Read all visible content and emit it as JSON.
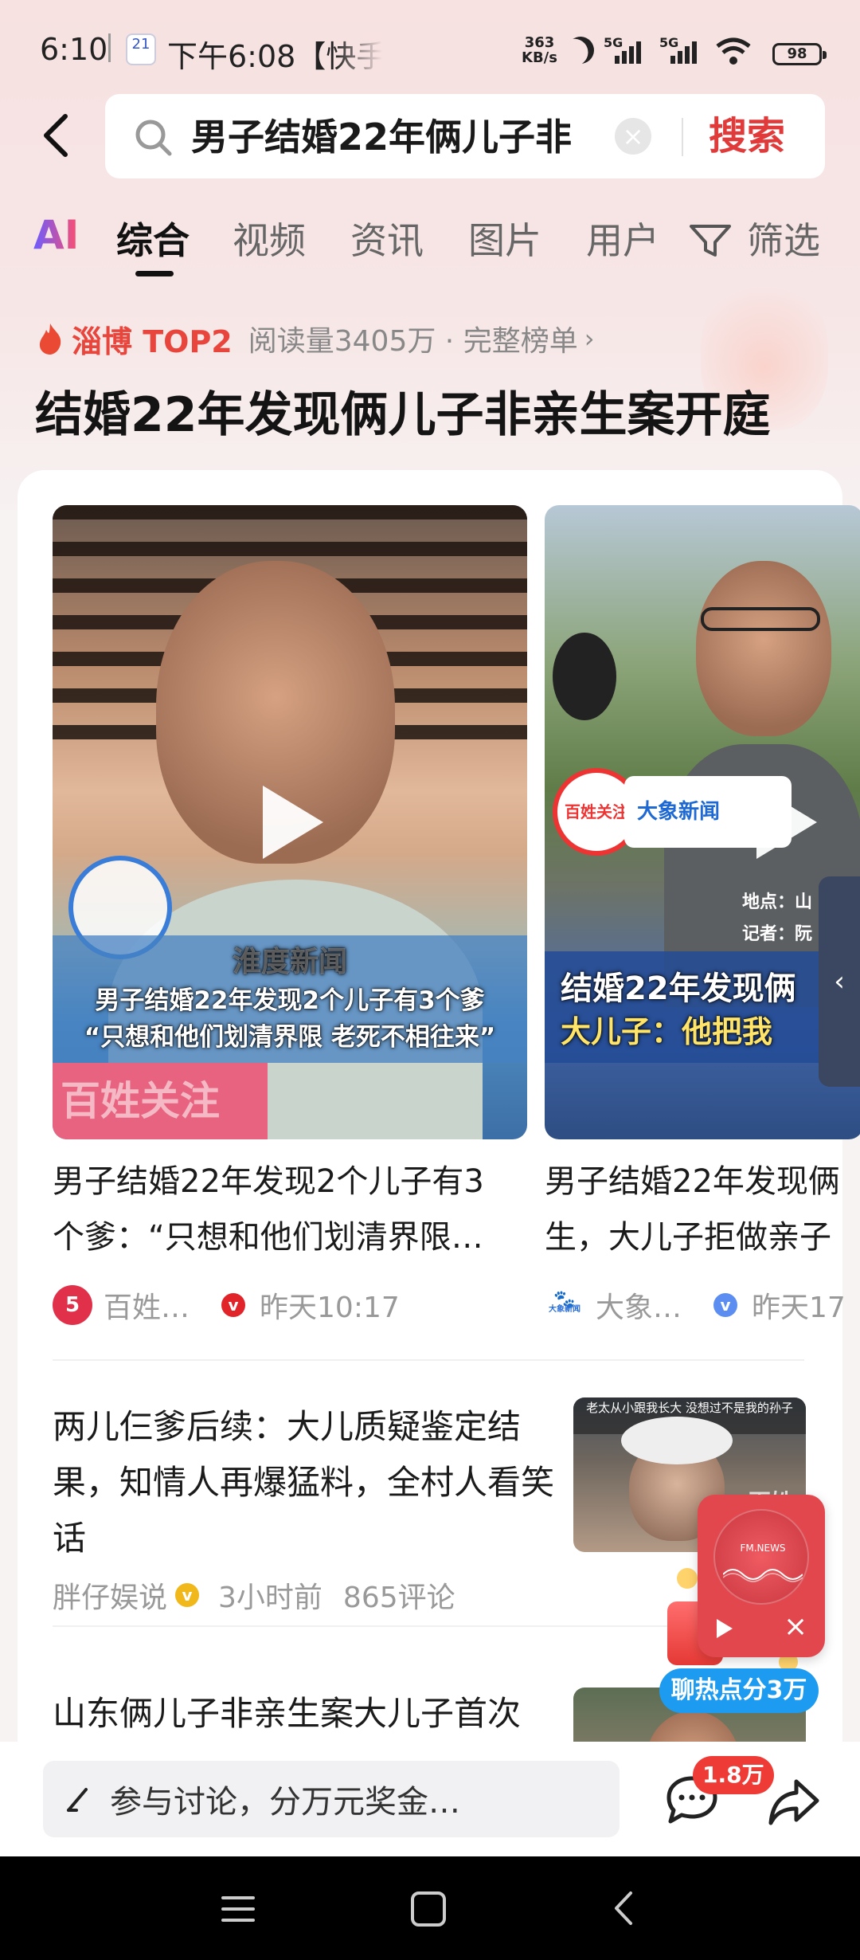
{
  "status_bar": {
    "time": "6:10",
    "calendar_day": "21",
    "notification": "下午6:08【快手",
    "net_speed_value": "363",
    "net_speed_unit": "KB/s",
    "signal1": "5G",
    "signal2": "5G",
    "battery": "98"
  },
  "search": {
    "query": "男子结婚22年俩儿子非",
    "button": "搜索"
  },
  "tabs": [
    {
      "label": "AI"
    },
    {
      "label": "综合",
      "active": true
    },
    {
      "label": "视频"
    },
    {
      "label": "资讯"
    },
    {
      "label": "图片"
    },
    {
      "label": "用户"
    },
    {
      "label": "筛选"
    }
  ],
  "hot": {
    "rank": "淄博 TOP2",
    "meta": "阅读量3405万 · 完整榜单",
    "headline": "结婚22年发现俩儿子非亲生案开庭"
  },
  "videos": [
    {
      "caption_line1": "男子结婚22年发现2个儿子有3个爹",
      "caption_line2": "“只想和他们划清界限 老死不相往来”",
      "overlay_brand": "淮度新闻",
      "overlay_bottom": "百姓关注",
      "title_line1": "男子结婚22年发现2个儿子有3",
      "title_line2": "个爹：“只想和他们划清界限…",
      "source": "百姓…",
      "time": "昨天10:17",
      "verify_color": "#e0242a"
    },
    {
      "caption_line1": "结婚22年发现俩",
      "caption_line2": "大儿子：他把我",
      "overlay_brand": "大象新闻",
      "overlay_mic": "百姓关注",
      "loc_label": "地点：山",
      "rep_label": "记者：阮",
      "title_line1": "男子结婚22年发现俩",
      "title_line2": "生，大儿子拒做亲子",
      "source": "大象…",
      "source_logo_text": "大象新闻",
      "time": "昨天17",
      "verify_color": "#5b8ef0"
    }
  ],
  "articles": [
    {
      "title": "两儿仨爹后续：大儿质疑鉴定结果，知情人再爆猛料，全村人看笑话",
      "author": "胖仔娱说",
      "time": "3小时前",
      "comments": "865评论",
      "thumb_caption": "老太从小跟我长大 没想过不是我的孙子",
      "thumb_brand": "百姓"
    },
    {
      "title": "山东俩儿子非亲生案大儿子首次"
    }
  ],
  "fm_widget": {
    "label": "FM.NEWS",
    "hot_points": "聊热点分3万"
  },
  "bottom": {
    "comment_placeholder": "参与讨论，分万元奖金…",
    "comment_count": "1.8万"
  },
  "colors": {
    "accent_red": "#e03a3a",
    "hot_red": "#e8453c",
    "pill_blue": "#1d9bf0"
  },
  "icons": [
    "back-arrow-icon",
    "search-icon",
    "clear-icon",
    "filter-icon",
    "flame-icon",
    "play-icon",
    "chat-bubble-icon",
    "share-icon",
    "pen-icon",
    "menu-icon",
    "home-icon",
    "nav-back-icon"
  ]
}
